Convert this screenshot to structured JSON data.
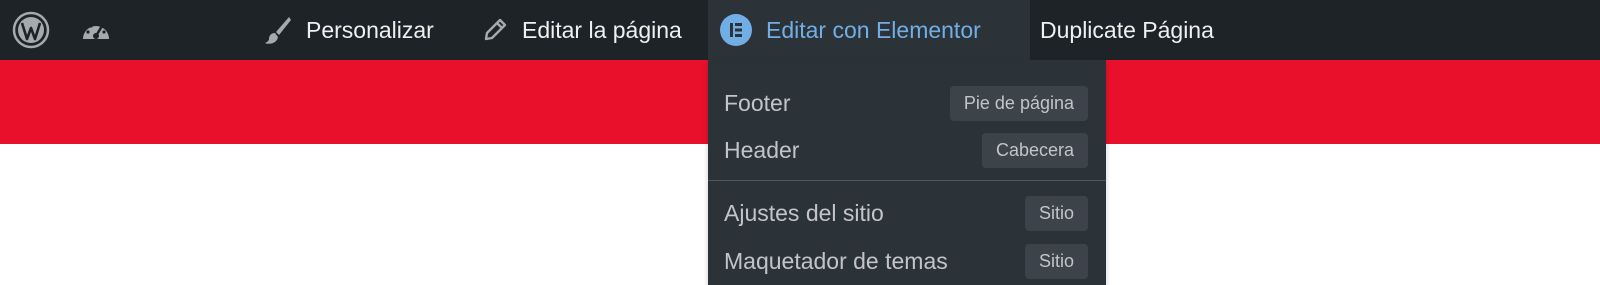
{
  "adminbar": {
    "wp_logo_icon": "wordpress-logo-icon",
    "dashboard_icon": "dashboard-gauge-icon",
    "customize_label": "Personalizar",
    "customize_icon": "paintbrush-icon",
    "edit_label": "Editar la página",
    "edit_icon": "pencil-icon",
    "elementor_label": "Editar con Elementor",
    "elementor_icon": "elementor-logo-icon",
    "duplicate_label": "Duplicate Página"
  },
  "colors": {
    "bar_bg": "#1d2327",
    "dropdown_bg": "#2c3338",
    "accent_link": "#72aee6",
    "red_band": "#e8102a",
    "elementor_icon_bg": "#72aee6"
  },
  "dropdown": {
    "items": [
      {
        "label": "Footer",
        "badge": "Pie de página"
      },
      {
        "label": "Header",
        "badge": "Cabecera"
      },
      {
        "label": "Ajustes del sitio",
        "badge": "Sitio"
      },
      {
        "label": "Maquetador de temas",
        "badge": "Sitio"
      }
    ]
  }
}
